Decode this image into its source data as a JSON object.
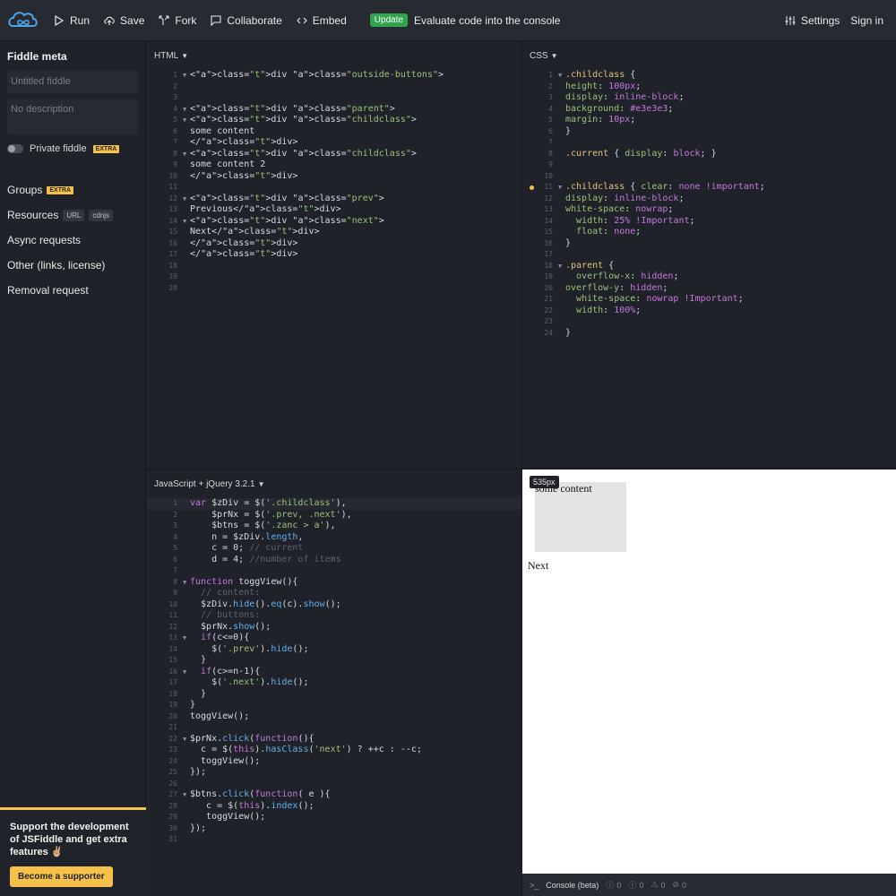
{
  "topbar": {
    "run": "Run",
    "save": "Save",
    "fork": "Fork",
    "collaborate": "Collaborate",
    "embed": "Embed",
    "update_badge": "Update",
    "update_text": "Evaluate code into the console",
    "settings": "Settings",
    "signin": "Sign in"
  },
  "sidebar": {
    "meta_title": "Fiddle meta",
    "title_placeholder": "Untitled fiddle",
    "desc_placeholder": "No description",
    "private_label": "Private fiddle",
    "extra": "EXTRA",
    "groups": "Groups",
    "resources": "Resources",
    "url_pill": "URL",
    "cdnjs_pill": "cdnjs",
    "async": "Async requests",
    "other": "Other (links, license)",
    "removal": "Removal request",
    "support_text": "Support the development of JSFiddle and get extra features ✌🏼",
    "support_button": "Become a supporter"
  },
  "panels": {
    "html_label": "HTML",
    "css_label": "CSS",
    "js_label": "JavaScript + jQuery 3.2.1"
  },
  "result": {
    "width_tag": "535px",
    "some_content": "some content",
    "next": "Next"
  },
  "console": {
    "label": "Console (beta)",
    "c1": "0",
    "c2": "0",
    "c3": "0",
    "c4": "0"
  },
  "colors": {
    "accent_green": "#2ea44f",
    "extra_yellow": "#f5c14b",
    "editor_bg": "#1f2228",
    "topbar_bg": "#272a31"
  },
  "html_code": [
    "<div class=\"outside-buttons\">",
    "",
    "",
    "<div class=\"parent\">",
    "<div class=\"childclass\">",
    "some content",
    "</div>",
    "<div class=\"childclass\">",
    "some content 2",
    "</div>",
    "",
    "<div class=\"prev\">",
    "Previous</div>",
    "<div class=\"next\">",
    "Next</div>",
    "</div>",
    "</div>",
    "",
    "",
    ""
  ],
  "css_code": [
    ".childclass {",
    "height: 100px;",
    "display: inline-block;",
    "background: #e3e3e3;",
    "margin: 10px;",
    "}",
    "",
    ".current { display: block; }",
    "",
    "",
    ".childclass { clear: none !important;",
    "display: inline-block;",
    "white-space: nowrap;",
    "  width: 25% !Important;",
    "  float: none;",
    "}",
    "",
    ".parent {",
    "  overflow-x: hidden;",
    "overflow-y: hidden;",
    "  white-space: nowrap !Important;",
    "  width: 100%;",
    "",
    "}"
  ],
  "js_code": [
    "var $zDiv = $('.childclass'),",
    "    $prNx = $('.prev, .next'),",
    "    $btns = $('.zanc > a'),",
    "    n = $zDiv.length,",
    "    c = 0; // current",
    "    d = 4; //number of items",
    "",
    "function toggView(){",
    "  // content:",
    "  $zDiv.hide().eq(c).show();",
    "  // buttons:",
    "  $prNx.show();",
    "  if(c<=0){",
    "    $('.prev').hide();",
    "  }",
    "  if(c>=n-1){",
    "    $('.next').hide();",
    "  }",
    "}",
    "toggView();",
    "",
    "$prNx.click(function(){",
    "  c = $(this).hasClass('next') ? ++c : --c;",
    "  toggView();",
    "});",
    "",
    "$btns.click(function( e ){",
    "   c = $(this).index();",
    "   toggView();",
    "});",
    ""
  ]
}
